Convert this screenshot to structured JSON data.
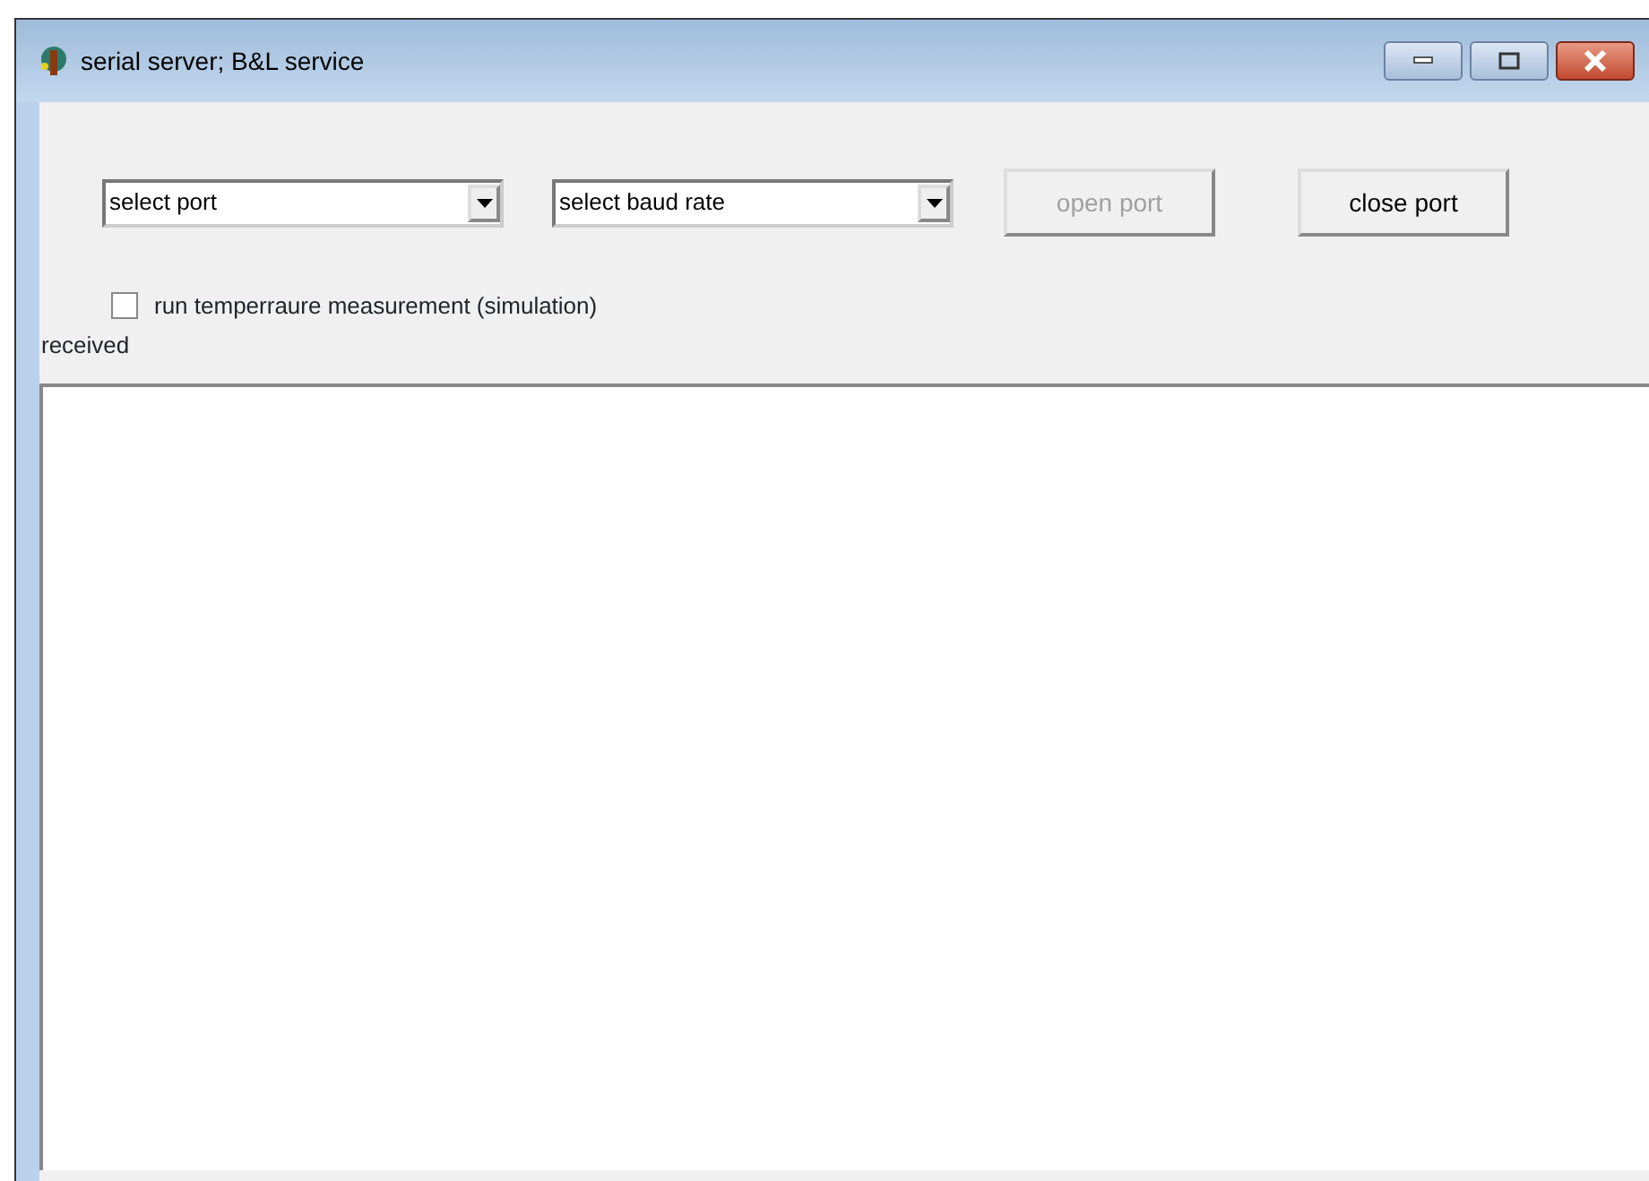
{
  "window": {
    "title": "serial server; B&L service"
  },
  "port_select": {
    "value": "select port"
  },
  "baud_select": {
    "value": "select baud rate"
  },
  "buttons": [
    {
      "label": "open port",
      "disabled": true
    },
    {
      "label": "close port",
      "disabled": false
    }
  ],
  "simulation_checkbox": {
    "label": "run temperraure measurement (simulation)",
    "checked": false
  },
  "received_label": "received"
}
